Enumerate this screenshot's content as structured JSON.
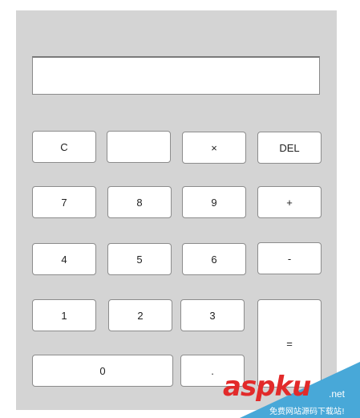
{
  "display": {
    "value": ""
  },
  "keys": {
    "clear": "C",
    "blank": "",
    "multiply": "×",
    "delete": "DEL",
    "seven": "7",
    "eight": "8",
    "nine": "9",
    "plus": "+",
    "four": "4",
    "five": "5",
    "six": "6",
    "minus": "-",
    "one": "1",
    "two": "2",
    "three": "3",
    "equals": "=",
    "zero": "0",
    "dot": "."
  },
  "watermark": {
    "logo_main": "asp",
    "logo_accent": "ku",
    "domain_suffix": ".net",
    "subtitle": "免费网站源码下载站!"
  },
  "colors": {
    "panel": "#d4d4d4",
    "key_bg": "#ffffff",
    "key_border": "#8c8c8c",
    "watermark_red": "#e22a2a",
    "watermark_blue": "#48a8d8"
  }
}
